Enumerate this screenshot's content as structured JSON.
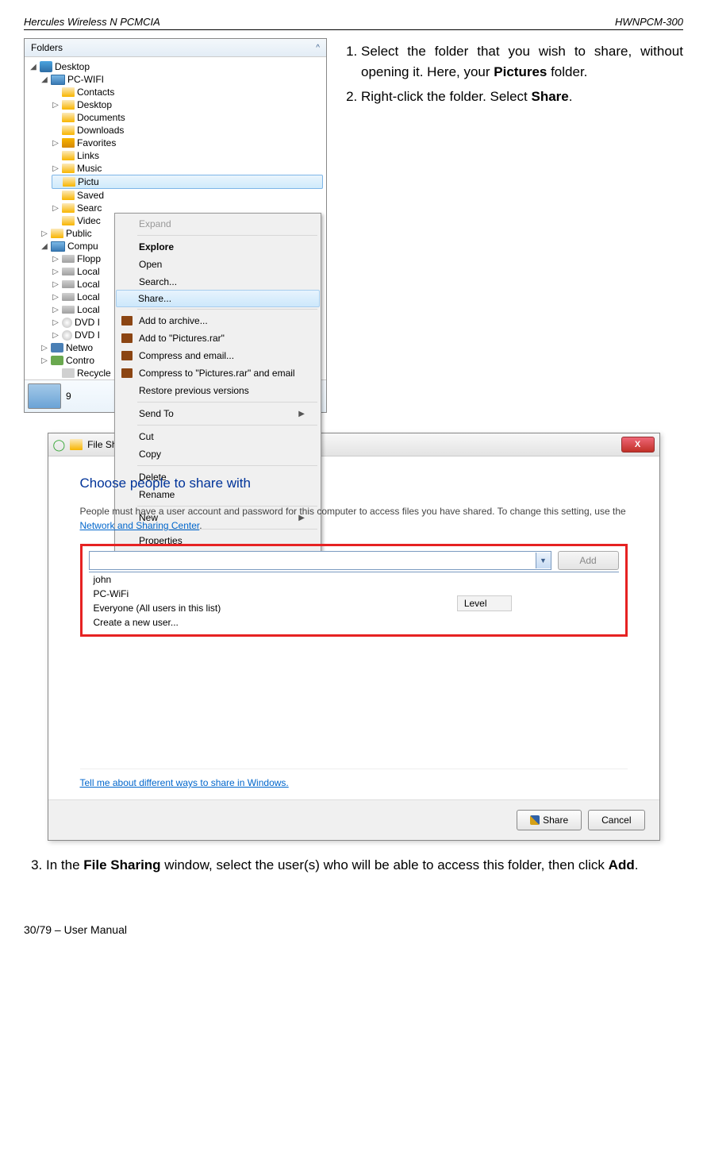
{
  "header": {
    "left": "Hercules Wireless N PCMCIA",
    "right": "HWNPCM-300"
  },
  "instructions": {
    "item1_a": "Select the folder that you wish to share, without opening it.  Here, your ",
    "item1_b": "Pictures",
    "item1_c": " folder.",
    "item2_a": "Right-click the folder.  Select ",
    "item2_b": "Share",
    "item2_c": "."
  },
  "tree": {
    "title": "Folders",
    "up_icon": "^",
    "desktop": "Desktop",
    "pcwifi": "PC-WIFI",
    "contacts": "Contacts",
    "desktop2": "Desktop",
    "documents": "Documents",
    "downloads": "Downloads",
    "favorites": "Favorites",
    "links": "Links",
    "music": "Music",
    "pictu": "Pictu",
    "saved": "Saved",
    "searc": "Searc",
    "videc": "Videc",
    "public": "Public",
    "compu": "Compu",
    "flopp": "Flopp",
    "local1": "Local",
    "local2": "Local",
    "local3": "Local",
    "local4": "Local",
    "dvd1": "DVD I",
    "dvd2": "DVD I",
    "netwo": "Netwo",
    "contro": "Contro",
    "recycle": "Recycle",
    "nine": "9"
  },
  "ctx": {
    "expand": "Expand",
    "explore": "Explore",
    "open": "Open",
    "search": "Search...",
    "share": "Share...",
    "addarchive": "Add to archive...",
    "addpictures": "Add to \"Pictures.rar\"",
    "compressemail": "Compress and email...",
    "compresspic": "Compress to \"Pictures.rar\" and email",
    "restore": "Restore previous versions",
    "sendto": "Send To",
    "cut": "Cut",
    "copy": "Copy",
    "delete": "Delete",
    "rename": "Rename",
    "new": "New",
    "properties": "Properties"
  },
  "dialog": {
    "title": "File Sharing",
    "heading": "Choose people to share with",
    "body_a": "People must have a user account and password for this computer to access files you have shared.  To change this setting, use the ",
    "body_link": "Network and Sharing Center",
    "body_b": ".",
    "add": "Add",
    "level": "Level",
    "dd1": "john",
    "dd2": "PC-WiFi",
    "dd3": "Everyone (All users in this list)",
    "dd4": "Create a new user...",
    "tell": "Tell me about different ways to share in Windows.",
    "share_btn": "Share",
    "cancel_btn": "Cancel"
  },
  "instr3_a": "In the ",
  "instr3_b": "File Sharing",
  "instr3_c": " window, select the user(s) who will be able to access this folder, then click ",
  "instr3_d": "Add",
  "instr3_e": ".",
  "footer": "30/79 – User Manual"
}
